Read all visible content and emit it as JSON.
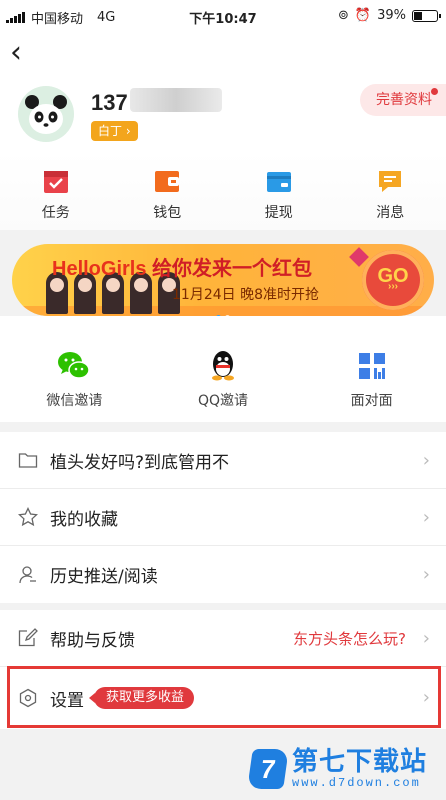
{
  "status_bar": {
    "carrier": "中国移动",
    "network": "4G",
    "time": "下午10:47",
    "battery": "39%",
    "battery_level": 0.39
  },
  "header": {
    "username_visible": "137",
    "level_badge": "白丁 ›",
    "complete_profile": "完善资料"
  },
  "quick_actions": [
    {
      "label": "任务",
      "icon": "task-icon",
      "color": "#e9424a"
    },
    {
      "label": "钱包",
      "icon": "wallet-icon",
      "color": "#f26b1d"
    },
    {
      "label": "提现",
      "icon": "withdraw-icon",
      "color": "#2a9ae6"
    },
    {
      "label": "消息",
      "icon": "message-icon",
      "color": "#f5a623"
    }
  ],
  "banner": {
    "title_a": "HelloGirls",
    "title_b": "给你发来一个红包",
    "subtitle": "11月24日 晚8准时开抢",
    "go": "GO",
    "go_arrows": "›››"
  },
  "invites": [
    {
      "label": "微信邀请",
      "icon": "wechat-icon",
      "color": "#2dc100"
    },
    {
      "label": "QQ邀请",
      "icon": "qq-icon",
      "color": "#111111"
    },
    {
      "label": "面对面",
      "icon": "qr-grid-icon",
      "color": "#3d7ee6"
    }
  ],
  "menu_group1": [
    {
      "label": "植头发好吗?到底管用不",
      "icon": "folder-icon"
    },
    {
      "label": "我的收藏",
      "icon": "star-icon"
    },
    {
      "label": "历史推送/阅读",
      "icon": "person-icon"
    }
  ],
  "menu_group2": [
    {
      "label": "帮助与反馈",
      "icon": "edit-icon",
      "right_text": "东方头条怎么玩?"
    },
    {
      "label": "设置",
      "icon": "hexagon-icon",
      "tag": "获取更多收益"
    }
  ],
  "watermark": {
    "logo_char": "7",
    "name": "第七下载站",
    "url": "www.d7down.com"
  },
  "colors": {
    "accent": "#e0393d",
    "level_badge": "#f3a51c",
    "highlight_frame": "#e53935"
  }
}
